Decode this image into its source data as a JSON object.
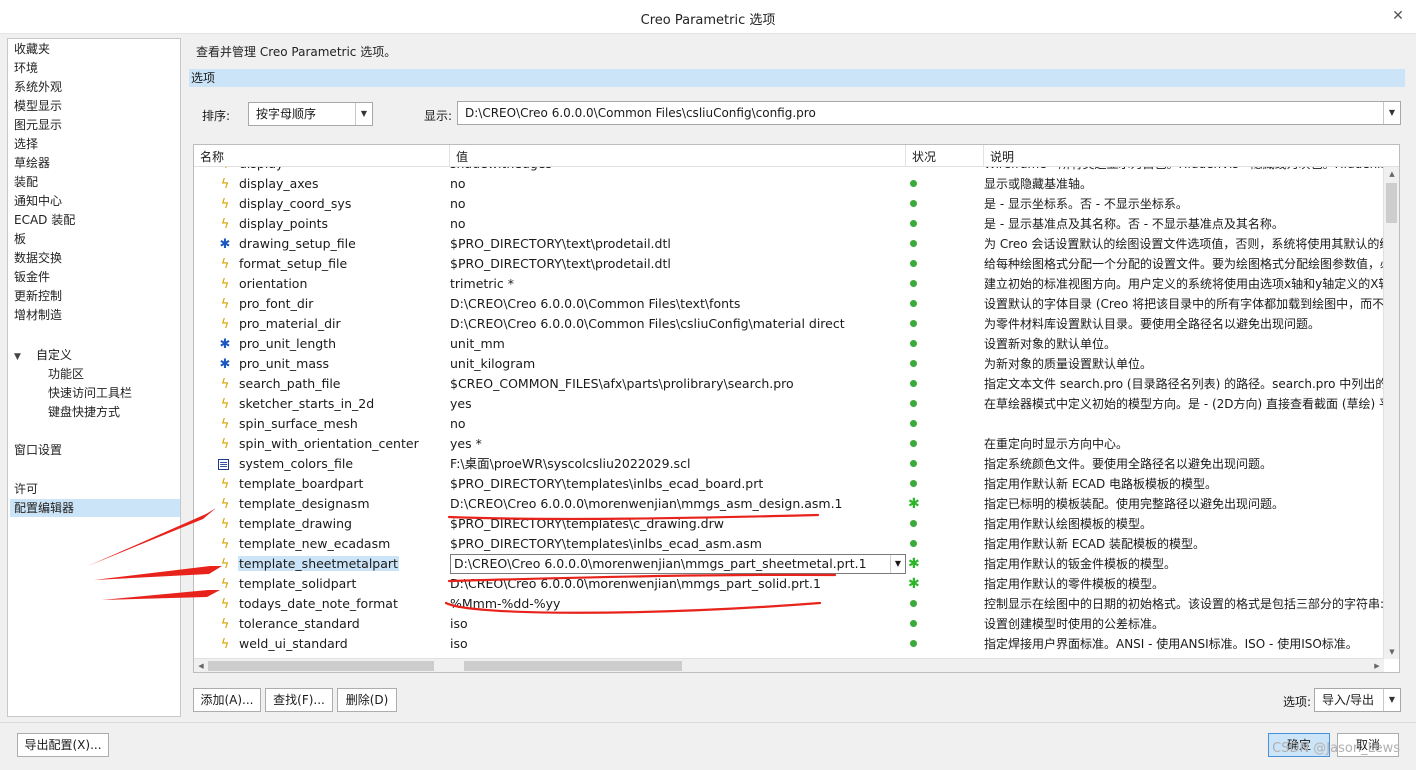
{
  "window": {
    "title": "Creo Parametric 选项"
  },
  "sidebar": {
    "items": [
      "收藏夹",
      "环境",
      "系统外观",
      "模型显示",
      "图元显示",
      "选择",
      "草绘器",
      "装配",
      "通知中心",
      "ECAD 装配",
      "板",
      "数据交换",
      "钣金件",
      "更新控制",
      "增材制造"
    ],
    "custom_group": "自定义",
    "custom_children": [
      "功能区",
      "快速访问工具栏",
      "键盘快捷方式"
    ],
    "window_settings": "窗口设置",
    "license": "许可",
    "config_editor": "配置编辑器"
  },
  "main": {
    "description": "查看并管理 Creo Parametric 选项。",
    "section": "选项",
    "sort_label": "排序:",
    "sort_value": "按字母顺序",
    "display_label": "显示:",
    "display_value": "D:\\CREO\\Creo 6.0.0.0\\Common Files\\csliuConfig\\config.pro"
  },
  "table": {
    "headers": {
      "name": "名称",
      "value": "值",
      "status": "状况",
      "desc": "说明"
    },
    "rows": [
      {
        "icon": "bolt-icon",
        "name": "display",
        "value": "shadewithedges",
        "status": "dot",
        "desc": "Wireframe - 所有类边显示为白色。HiddenVis - 隐藏线为灰色。Hiddenln"
      },
      {
        "icon": "bolt-icon",
        "name": "display_axes",
        "value": "no",
        "status": "dot",
        "desc": "显示或隐藏基准轴。"
      },
      {
        "icon": "bolt-icon",
        "name": "display_coord_sys",
        "value": "no",
        "status": "dot",
        "desc": "是 - 显示坐标系。否 - 不显示坐标系。"
      },
      {
        "icon": "bolt-icon",
        "name": "display_points",
        "value": "no",
        "status": "dot",
        "desc": "是 - 显示基准点及其名称。否 - 不显示基准点及其名称。"
      },
      {
        "icon": "wand-icon",
        "name": "drawing_setup_file",
        "value": "$PRO_DIRECTORY\\text\\prodetail.dtl",
        "status": "dot",
        "desc": "为 Creo 会话设置默认的绘图设置文件选项值，否则，系统将使用其默认的绘"
      },
      {
        "icon": "bolt-icon",
        "name": "format_setup_file",
        "value": "$PRO_DIRECTORY\\text\\prodetail.dtl",
        "status": "dot",
        "desc": "给每种绘图格式分配一个分配的设置文件。要为绘图格式分配绘图参数值，必"
      },
      {
        "icon": "bolt-icon",
        "name": "orientation",
        "value": "trimetric *",
        "status": "dot",
        "desc": "建立初始的标准视图方向。用户定义的系统将使用由选项x轴和y轴定义的X轴"
      },
      {
        "icon": "bolt-icon",
        "name": "pro_font_dir",
        "value": "D:\\CREO\\Creo 6.0.0.0\\Common Files\\text\\fonts",
        "status": "dot",
        "desc": "设置默认的字体目录 (Creo 将把该目录中的所有字体都加载到绘图中，而不"
      },
      {
        "icon": "bolt-icon",
        "name": "pro_material_dir",
        "value": "D:\\CREO\\Creo 6.0.0.0\\Common Files\\csliuConfig\\material direct",
        "status": "dot",
        "desc": "为零件材料库设置默认目录。要使用全路径名以避免出现问题。"
      },
      {
        "icon": "wand-icon",
        "name": "pro_unit_length",
        "value": "unit_mm",
        "status": "dot",
        "desc": "设置新对象的默认单位。"
      },
      {
        "icon": "wand-icon",
        "name": "pro_unit_mass",
        "value": "unit_kilogram",
        "status": "dot",
        "desc": "为新对象的质量设置默认单位。"
      },
      {
        "icon": "bolt-icon",
        "name": "search_path_file",
        "value": "$CREO_COMMON_FILES\\afx\\parts\\prolibrary\\search.pro",
        "status": "dot",
        "desc": "指定文本文件 search.pro (目录路径名列表) 的路径。search.pro 中列出的"
      },
      {
        "icon": "bolt-icon",
        "name": "sketcher_starts_in_2d",
        "value": "yes",
        "status": "dot",
        "desc": "在草绘器模式中定义初始的模型方向。是 - (2D方向) 直接查看截面 (草绘) 平"
      },
      {
        "icon": "bolt-icon",
        "name": "spin_surface_mesh",
        "value": "no",
        "status": "dot",
        "desc": ""
      },
      {
        "icon": "bolt-icon",
        "name": "spin_with_orientation_center",
        "value": "yes *",
        "status": "dot",
        "desc": "在重定向时显示方向中心。"
      },
      {
        "icon": "box-icon",
        "name": "system_colors_file",
        "value": "F:\\桌面\\proeWR\\syscolcsliu2022029.scl",
        "status": "dot",
        "desc": "指定系统颜色文件。要使用全路径名以避免出现问题。"
      },
      {
        "icon": "bolt-icon",
        "name": "template_boardpart",
        "value": "$PRO_DIRECTORY\\templates\\inlbs_ecad_board.prt",
        "status": "dot",
        "desc": "指定用作默认新 ECAD 电路板模板的模型。"
      },
      {
        "icon": "bolt-icon",
        "name": "template_designasm",
        "value": "D:\\CREO\\Creo 6.0.0.0\\morenwenjian\\mmgs_asm_design.asm.1",
        "status": "star",
        "desc": "指定已标明的模板装配。使用完整路径以避免出现问题。"
      },
      {
        "icon": "bolt-icon",
        "name": "template_drawing",
        "value": "$PRO_DIRECTORY\\templates\\c_drawing.drw",
        "status": "dot",
        "desc": "指定用作默认绘图模板的模型。"
      },
      {
        "icon": "bolt-icon",
        "name": "template_new_ecadasm",
        "value": "$PRO_DIRECTORY\\templates\\inlbs_ecad_asm.asm",
        "status": "dot",
        "desc": "指定用作默认新 ECAD 装配模板的模型。"
      },
      {
        "icon": "bolt-icon",
        "name": "template_sheetmetalpart",
        "value": "D:\\CREO\\Creo 6.0.0.0\\morenwenjian\\mmgs_part_sheetmetal.prt.1",
        "status": "star",
        "desc": "指定用作默认的钣金件模板的模型。",
        "selected": true
      },
      {
        "icon": "bolt-icon",
        "name": "template_solidpart",
        "value": "D:\\CREO\\Creo 6.0.0.0\\morenwenjian\\mmgs_part_solid.prt.1",
        "status": "star",
        "desc": "指定用作默认的零件模板的模型。"
      },
      {
        "icon": "bolt-icon",
        "name": "todays_date_note_format",
        "value": "%Mmm-%dd-%yy",
        "status": "dot",
        "desc": "控制显示在绘图中的日期的初始格式。该设置的格式是包括三部分的字符串:"
      },
      {
        "icon": "bolt-icon",
        "name": "tolerance_standard",
        "value": "iso",
        "status": "dot",
        "desc": "设置创建模型时使用的公差标准。"
      },
      {
        "icon": "bolt-icon",
        "name": "weld_ui_standard",
        "value": "iso",
        "status": "dot",
        "desc": "指定焊接用户界面标准。ANSI - 使用ANSI标准。ISO - 使用ISO标准。"
      }
    ]
  },
  "buttons": {
    "add": "添加(A)...",
    "find": "查找(F)...",
    "delete": "删除(D)",
    "options_label": "选项:",
    "import_export": "导入/导出",
    "export_config": "导出配置(X)...",
    "ok": "确定",
    "cancel": "取消"
  },
  "watermark": "CSDN @Jason_Lews",
  "colors": {
    "selection": "#cce4f7",
    "status_green": "#3aaa3a",
    "annotation_red": "#e8231c"
  }
}
